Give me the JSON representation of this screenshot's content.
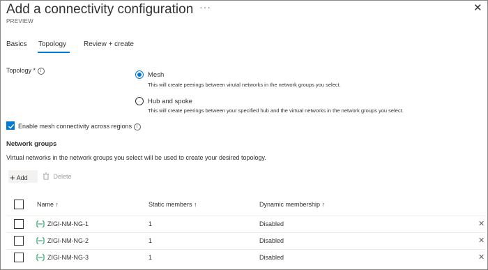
{
  "header": {
    "title": "Add a connectivity configuration",
    "preview": "PREVIEW",
    "more": "···",
    "close": "✕"
  },
  "tabs": [
    {
      "label": "Basics",
      "active": false
    },
    {
      "label": "Topology",
      "active": true
    },
    {
      "label": "Review + create",
      "active": false
    }
  ],
  "topology": {
    "label": "Topology",
    "required_mark": "*",
    "options": [
      {
        "label": "Mesh",
        "description": "This will create peerings between virutal networks in the network groups you select.",
        "selected": true
      },
      {
        "label": "Hub and spoke",
        "description": "This will create peerings between your specified hub and the virtual networks in the network groups you select.",
        "selected": false
      }
    ]
  },
  "mesh_regions": {
    "label": "Enable mesh connectivity across regions",
    "checked": true
  },
  "network_groups": {
    "title": "Network groups",
    "description": "Virtual networks in the network groups you select will be used to create your desired topology.",
    "toolbar": {
      "add_label": "Add",
      "delete_label": "Delete"
    },
    "columns": [
      "Name ↑",
      "Static members ↑",
      "Dynamic membership ↑"
    ],
    "rows": [
      {
        "name": "ZIGI-NM-NG-1",
        "static_members": "1",
        "dynamic_membership": "Disabled"
      },
      {
        "name": "ZIGI-NM-NG-2",
        "static_members": "1",
        "dynamic_membership": "Disabled"
      },
      {
        "name": "ZIGI-NM-NG-3",
        "static_members": "1",
        "dynamic_membership": "Disabled"
      }
    ]
  },
  "colors": {
    "accent": "#0078d4",
    "network_icon": "#2ea36a",
    "disabled_text": "#a19f9d"
  }
}
